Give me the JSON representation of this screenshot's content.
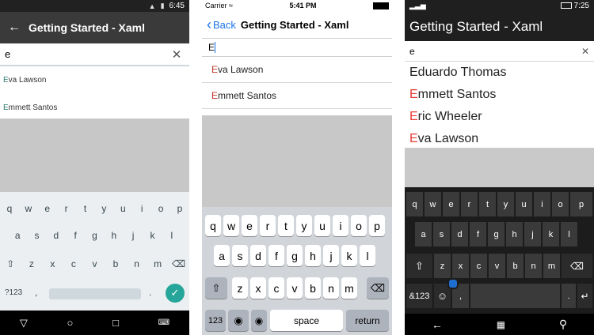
{
  "android": {
    "time": "6:45",
    "title": "Getting Started - Xaml",
    "search_value": "e",
    "results": [
      {
        "hl": "E",
        "rest": "va Lawson"
      },
      {
        "hl": "E",
        "rest": "mmett Santos"
      }
    ],
    "keys_row1": [
      "q",
      "w",
      "e",
      "r",
      "t",
      "y",
      "u",
      "i",
      "o",
      "p"
    ],
    "keys_row2": [
      "a",
      "s",
      "d",
      "f",
      "g",
      "h",
      "j",
      "k",
      "l"
    ],
    "keys_row3": [
      "z",
      "x",
      "c",
      "v",
      "b",
      "n",
      "m"
    ],
    "key_symbols": "?123",
    "key_comma": ",",
    "key_period": "."
  },
  "ios": {
    "carrier": "Carrier",
    "time": "5:41 PM",
    "back_label": "Back",
    "title": "Getting Started - Xaml",
    "search_value": "E",
    "results": [
      {
        "hl": "E",
        "rest": "va Lawson"
      },
      {
        "hl": "E",
        "rest": "mmett Santos"
      }
    ],
    "keys_row1": [
      "q",
      "w",
      "e",
      "r",
      "t",
      "y",
      "u",
      "i",
      "o",
      "p"
    ],
    "keys_row2": [
      "a",
      "s",
      "d",
      "f",
      "g",
      "h",
      "j",
      "k",
      "l"
    ],
    "keys_row3": [
      "z",
      "x",
      "c",
      "v",
      "b",
      "n",
      "m"
    ],
    "key_numbers": "123",
    "key_space": "space",
    "key_return": "return"
  },
  "windows": {
    "time": "7:25",
    "title": "Getting Started - Xaml",
    "search_value": "e",
    "results": [
      {
        "hl": "E",
        "rest": "duardo Thomas",
        "first_plain": true
      },
      {
        "hl": "E",
        "rest": "mmett Santos"
      },
      {
        "hl": "E",
        "rest": "ric Wheeler"
      },
      {
        "hl": "E",
        "rest": "va Lawson"
      }
    ],
    "keys_row1": [
      "q",
      "w",
      "e",
      "r",
      "t",
      "y",
      "u",
      "i",
      "o",
      "p"
    ],
    "keys_row2": [
      "a",
      "s",
      "d",
      "f",
      "g",
      "h",
      "j",
      "k",
      "l"
    ],
    "keys_row3": [
      "z",
      "x",
      "c",
      "v",
      "b",
      "n",
      "m"
    ],
    "key_symbols": "&123",
    "key_comma": ",",
    "key_period": "."
  }
}
